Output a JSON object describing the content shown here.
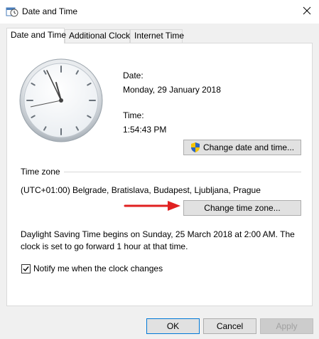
{
  "window": {
    "title": "Date and Time",
    "icon": "clock-calendar-icon"
  },
  "tabs": [
    {
      "label": "Date and Time",
      "active": true
    },
    {
      "label": "Additional Clocks",
      "active": false
    },
    {
      "label": "Internet Time",
      "active": false
    }
  ],
  "datetime": {
    "date_label": "Date:",
    "date_value": "Monday, 29 January 2018",
    "time_label": "Time:",
    "time_value": "1:54:43 PM",
    "change_button": "Change date and time..."
  },
  "timezone": {
    "section_label": "Time zone",
    "value": "(UTC+01:00) Belgrade, Bratislava, Budapest, Ljubljana, Prague",
    "change_button": "Change time zone..."
  },
  "dst": {
    "line1": "Daylight Saving Time begins on Sunday, 25 March 2018 at 2:00 AM. The",
    "line2": "clock is set to go forward 1 hour at that time."
  },
  "notify": {
    "label": "Notify me when the clock changes",
    "checked": true
  },
  "footer": {
    "ok": "OK",
    "cancel": "Cancel",
    "apply": "Apply"
  },
  "colors": {
    "arrow": "#e02020",
    "accent": "#0078d7"
  }
}
